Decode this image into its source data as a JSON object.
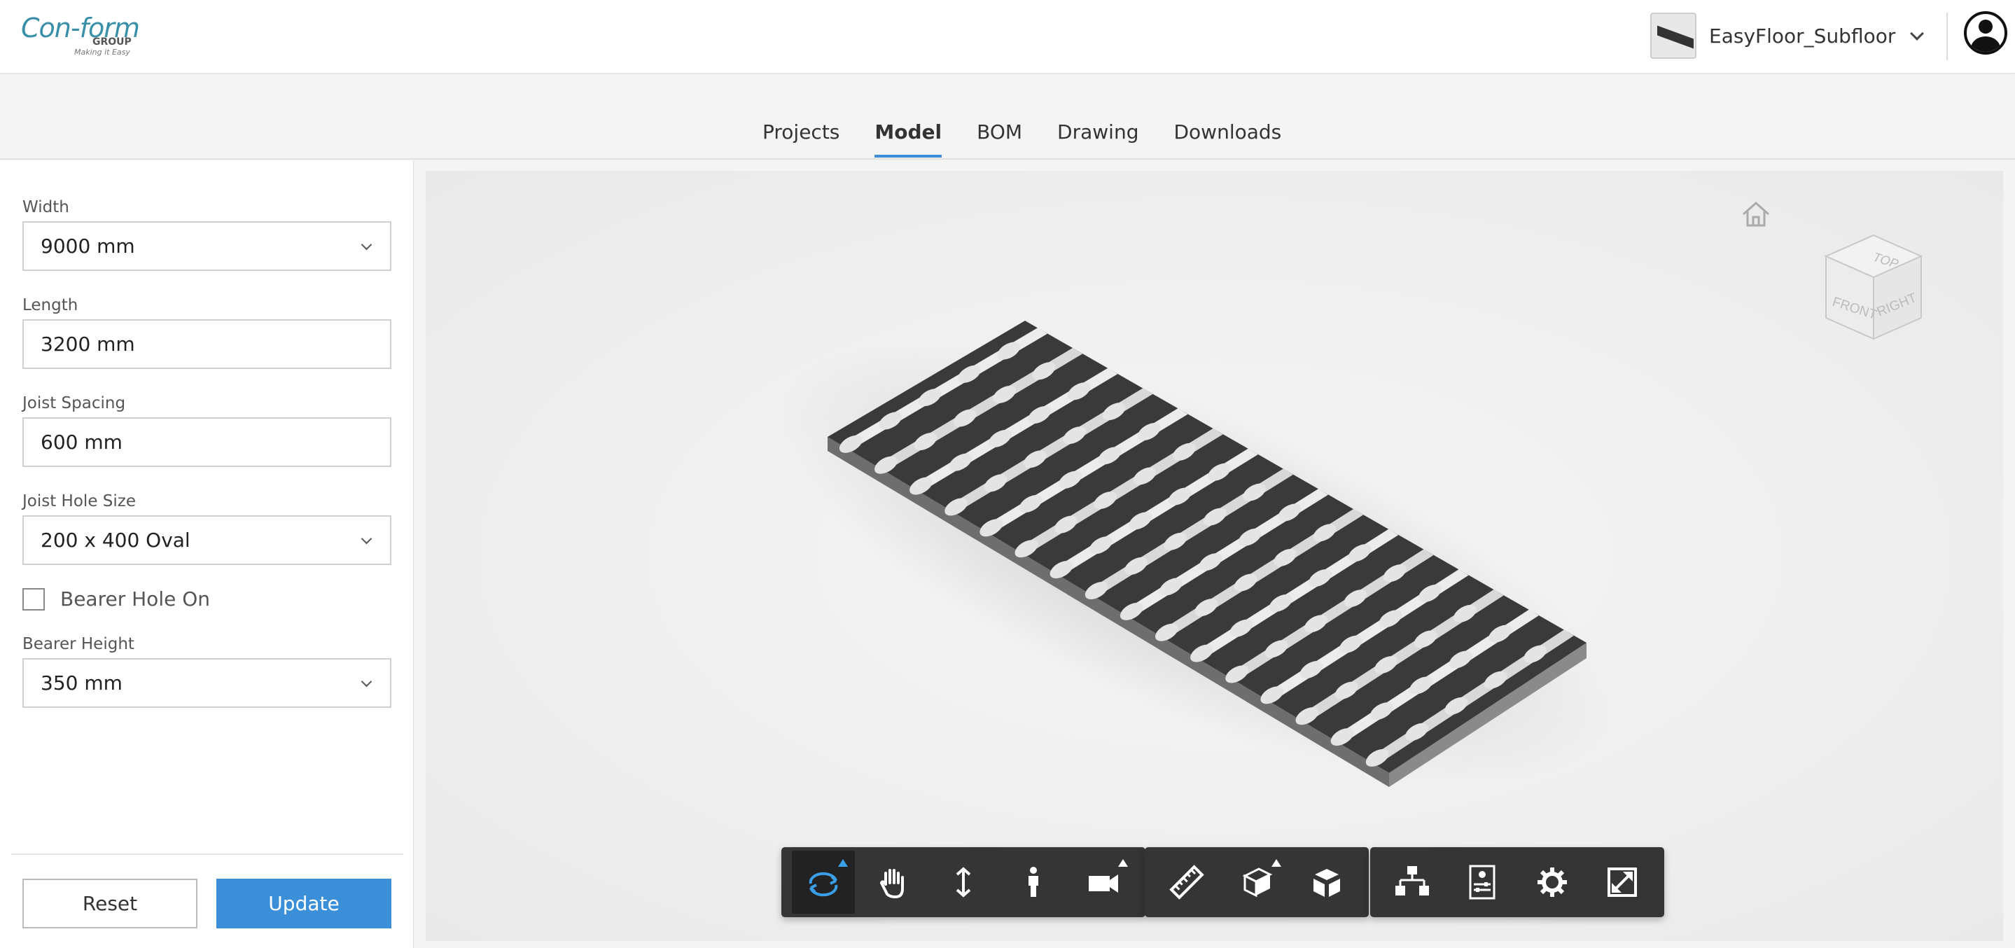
{
  "header": {
    "logo": {
      "main": "Con-form",
      "group": "GROUP",
      "tagline": "Making it Easy"
    },
    "product": {
      "name": "EasyFloor_Subfloor",
      "thumb_icon": "floor-panel-thumbnail"
    },
    "user_icon": "user-account-icon"
  },
  "tabs": [
    {
      "label": "Projects",
      "active": false
    },
    {
      "label": "Model",
      "active": true
    },
    {
      "label": "BOM",
      "active": false
    },
    {
      "label": "Drawing",
      "active": false
    },
    {
      "label": "Downloads",
      "active": false
    }
  ],
  "params": {
    "width": {
      "label": "Width",
      "value": "9000 mm"
    },
    "length": {
      "label": "Length",
      "value": "3200 mm"
    },
    "joist_spacing": {
      "label": "Joist Spacing",
      "value": "600 mm"
    },
    "joist_hole_size": {
      "label": "Joist Hole Size",
      "value": "200 x 400 Oval"
    },
    "bearer_hole": {
      "label": "Bearer Hole On",
      "checked": false
    },
    "bearer_height": {
      "label": "Bearer Height",
      "value": "350 mm"
    }
  },
  "actions": {
    "reset": "Reset",
    "update": "Update"
  },
  "viewer": {
    "viewcube": {
      "top": "TOP",
      "front": "FRONT",
      "right": "RIGHT"
    },
    "toolbar_groups": [
      [
        "orbit",
        "pan",
        "dolly",
        "walk",
        "camera"
      ],
      [
        "measure",
        "section",
        "explode"
      ],
      [
        "model-browser",
        "properties",
        "settings",
        "fullscreen"
      ]
    ]
  },
  "colors": {
    "accent": "#3b8fd8",
    "toolbar_bg": "#353535",
    "active_tool": "#3b9fe8"
  }
}
